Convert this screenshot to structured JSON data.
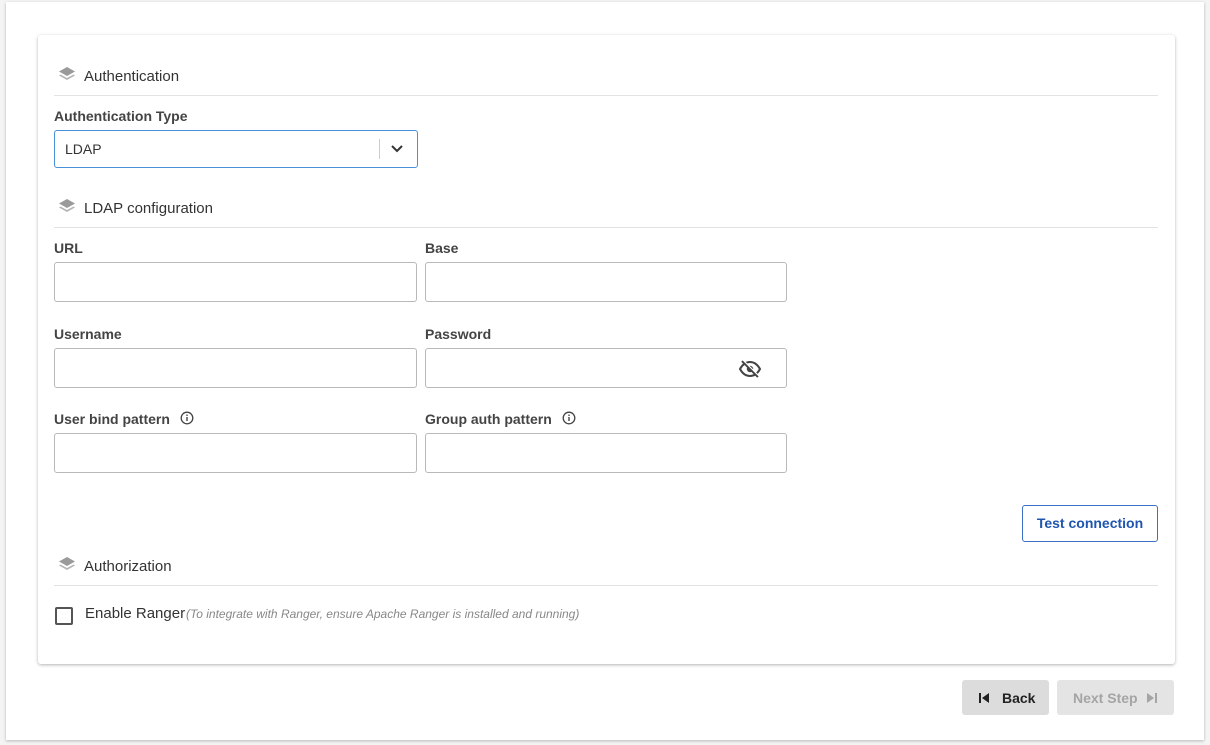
{
  "sections": {
    "authentication": {
      "title": "Authentication"
    },
    "ldap": {
      "title": "LDAP configuration"
    },
    "authorization": {
      "title": "Authorization"
    }
  },
  "auth_type": {
    "label": "Authentication Type",
    "value": "LDAP"
  },
  "fields": {
    "url": {
      "label": "URL",
      "value": ""
    },
    "base": {
      "label": "Base",
      "value": ""
    },
    "username": {
      "label": "Username",
      "value": ""
    },
    "password": {
      "label": "Password",
      "value": ""
    },
    "user_bind_pattern": {
      "label": "User bind pattern",
      "value": ""
    },
    "group_auth_pattern": {
      "label": "Group auth pattern",
      "value": ""
    }
  },
  "test_connection_label": "Test connection",
  "ranger": {
    "label": "Enable Ranger",
    "hint": "(To integrate with Ranger, ensure Apache Ranger is installed and running)",
    "checked": false
  },
  "footer": {
    "back_label": "Back",
    "next_label": "Next Step"
  },
  "icons": {
    "section": "layers-icon",
    "dropdown": "chevron-down-icon",
    "password_toggle": "eye-off-icon",
    "info": "info-icon",
    "back": "skip-back-icon",
    "next": "skip-forward-icon"
  }
}
